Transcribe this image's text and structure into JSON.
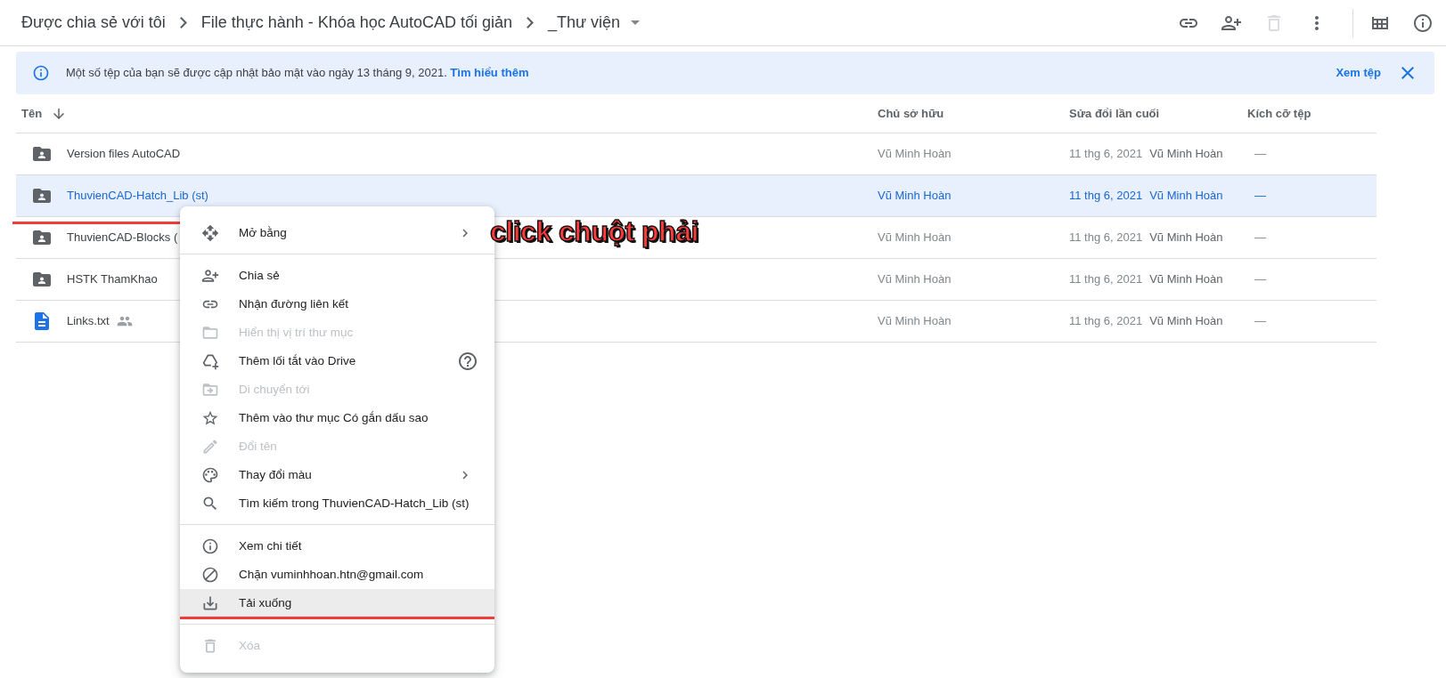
{
  "breadcrumb": [
    {
      "label": "Được chia sẻ với tôi",
      "dropdown": false
    },
    {
      "label": "File thực hành - Khóa học AutoCAD tối giản",
      "dropdown": false
    },
    {
      "label": "_Thư viện",
      "dropdown": true
    }
  ],
  "toolbar_buttons": [
    {
      "disabled": false
    },
    {
      "disabled": false
    },
    {
      "disabled": true
    },
    {
      "disabled": false
    },
    {
      "disabled": false
    },
    {
      "disabled": false
    }
  ],
  "banner": {
    "message": "Một số tệp của bạn sẽ được cập nhật bảo mật vào ngày 13 tháng 9, 2021.",
    "link": "Tìm hiểu thêm",
    "action": "Xem tệp"
  },
  "table": {
    "columns": [
      "Tên",
      "Chủ sở hữu",
      "Sửa đổi lần cuối",
      "Kích cỡ tệp"
    ],
    "rows": [
      {
        "kind": "folder",
        "name": "Version files AutoCAD",
        "shared": false,
        "selected": false,
        "owner": "Vũ Minh Hoàn",
        "modified": "11 thg 6, 2021",
        "modified_by": "Vũ Minh Hoàn",
        "size": "—"
      },
      {
        "kind": "folder",
        "name": "ThuvienCAD-Hatch_Lib (st)",
        "selected": true,
        "owner": "Vũ Minh Hoàn",
        "modified": "11 thg 6, 2021",
        "modified_by": "Vũ Minh Hoàn",
        "size": "—"
      },
      {
        "kind": "folder",
        "name": "ThuvienCAD-Blocks (",
        "selected": false,
        "owner": "Vũ Minh Hoàn",
        "modified": "11 thg 6, 2021",
        "modified_by": "Vũ Minh Hoàn",
        "size": "—"
      },
      {
        "kind": "folder",
        "name": "HSTK ThamKhao",
        "selected": false,
        "owner": "Vũ Minh Hoàn",
        "modified": "11 thg 6, 2021",
        "modified_by": "Vũ Minh Hoàn",
        "size": "—"
      },
      {
        "kind": "document",
        "name": "Links.txt",
        "shared": true,
        "selected": false,
        "owner": "Vũ Minh Hoàn",
        "modified": "11 thg 6, 2021",
        "modified_by": "Vũ Minh Hoàn",
        "size": "—"
      }
    ]
  },
  "context_menu": {
    "groups": [
      [
        {
          "label": "Mở bằng",
          "disabled": false,
          "submenu": true,
          "help": false,
          "selected": false
        }
      ],
      [
        {
          "label": "Chia sẻ",
          "disabled": false,
          "submenu": false,
          "help": false,
          "selected": false
        },
        {
          "label": "Nhận đường liên kết",
          "disabled": false,
          "submenu": false,
          "help": false,
          "selected": false
        },
        {
          "label": "Hiển thị vị trí thư mục",
          "disabled": true,
          "submenu": false,
          "help": false,
          "selected": false
        },
        {
          "label": "Thêm lối tắt vào Drive",
          "disabled": false,
          "submenu": false,
          "help": true,
          "selected": false
        },
        {
          "label": "Di chuyển tới",
          "disabled": true,
          "submenu": false,
          "help": false,
          "selected": false
        },
        {
          "label": "Thêm vào thư mục Có gắn dấu sao",
          "disabled": false,
          "submenu": false,
          "help": false,
          "selected": false
        },
        {
          "label": "Đổi tên",
          "disabled": true,
          "submenu": false,
          "help": false,
          "selected": false
        },
        {
          "label": "Thay đổi màu",
          "disabled": false,
          "submenu": true,
          "help": false,
          "selected": false
        },
        {
          "label": "Tìm kiếm trong ThuvienCAD-Hatch_Lib (st)",
          "disabled": false,
          "submenu": false,
          "help": false,
          "selected": false
        }
      ],
      [
        {
          "label": "Xem chi tiết",
          "disabled": false,
          "submenu": false,
          "help": false,
          "selected": false
        },
        {
          "label": "Chặn vuminhhoan.htn@gmail.com",
          "disabled": false,
          "submenu": false,
          "help": false,
          "selected": false
        },
        {
          "label": "Tải xuống",
          "disabled": false,
          "submenu": false,
          "help": false,
          "selected": true
        }
      ],
      [
        {
          "label": "Xóa",
          "disabled": true,
          "submenu": false,
          "help": false,
          "selected": false
        }
      ]
    ]
  },
  "annotation": {
    "text": "click chuột phải"
  }
}
